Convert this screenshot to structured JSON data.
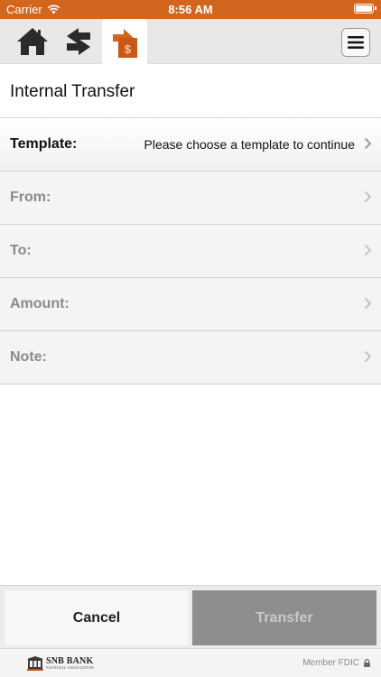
{
  "status": {
    "carrier": "Carrier",
    "time": "8:56 AM"
  },
  "nav": {
    "tabs": [
      {
        "icon": "home-icon",
        "active": false
      },
      {
        "icon": "swap-arrows-icon",
        "active": false
      },
      {
        "icon": "transfer-dollar-icon",
        "active": true
      }
    ],
    "menu_icon": "hamburger-menu-icon"
  },
  "page": {
    "title": "Internal Transfer"
  },
  "form": {
    "template": {
      "label": "Template:",
      "value": "Please choose a template to continue"
    },
    "from": {
      "label": "From:",
      "value": ""
    },
    "to": {
      "label": "To:",
      "value": ""
    },
    "amount": {
      "label": "Amount:",
      "value": ""
    },
    "note": {
      "label": "Note:",
      "value": ""
    }
  },
  "actions": {
    "cancel_label": "Cancel",
    "transfer_label": "Transfer"
  },
  "footer": {
    "logo_name": "SNB BANK",
    "logo_sub": "NATIONAL ASSOCIATION",
    "member": "Member FDIC"
  },
  "colors": {
    "accent": "#d2661f",
    "disabled": "#8e8e8e"
  }
}
